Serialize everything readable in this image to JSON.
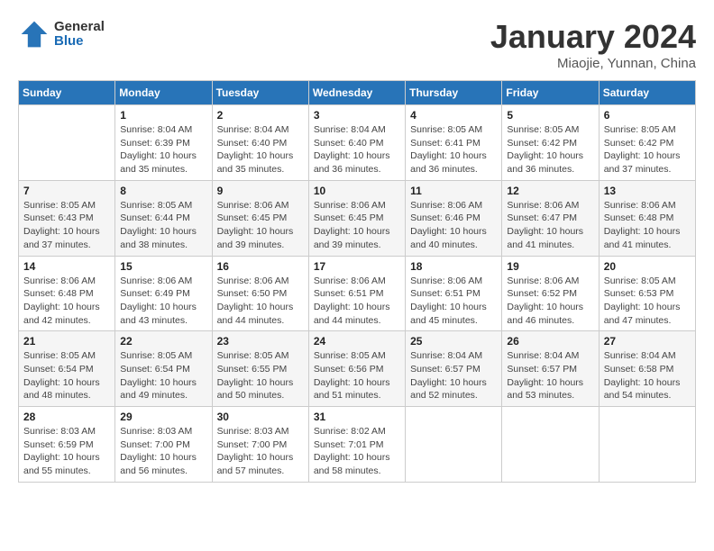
{
  "logo": {
    "general": "General",
    "blue": "Blue"
  },
  "title": "January 2024",
  "subtitle": "Miaojie, Yunnan, China",
  "weekdays": [
    "Sunday",
    "Monday",
    "Tuesday",
    "Wednesday",
    "Thursday",
    "Friday",
    "Saturday"
  ],
  "weeks": [
    [
      {
        "day": "",
        "sunrise": "",
        "sunset": "",
        "daylight": ""
      },
      {
        "day": "1",
        "sunrise": "Sunrise: 8:04 AM",
        "sunset": "Sunset: 6:39 PM",
        "daylight": "Daylight: 10 hours and 35 minutes."
      },
      {
        "day": "2",
        "sunrise": "Sunrise: 8:04 AM",
        "sunset": "Sunset: 6:40 PM",
        "daylight": "Daylight: 10 hours and 35 minutes."
      },
      {
        "day": "3",
        "sunrise": "Sunrise: 8:04 AM",
        "sunset": "Sunset: 6:40 PM",
        "daylight": "Daylight: 10 hours and 36 minutes."
      },
      {
        "day": "4",
        "sunrise": "Sunrise: 8:05 AM",
        "sunset": "Sunset: 6:41 PM",
        "daylight": "Daylight: 10 hours and 36 minutes."
      },
      {
        "day": "5",
        "sunrise": "Sunrise: 8:05 AM",
        "sunset": "Sunset: 6:42 PM",
        "daylight": "Daylight: 10 hours and 36 minutes."
      },
      {
        "day": "6",
        "sunrise": "Sunrise: 8:05 AM",
        "sunset": "Sunset: 6:42 PM",
        "daylight": "Daylight: 10 hours and 37 minutes."
      }
    ],
    [
      {
        "day": "7",
        "sunrise": "Sunrise: 8:05 AM",
        "sunset": "Sunset: 6:43 PM",
        "daylight": "Daylight: 10 hours and 37 minutes."
      },
      {
        "day": "8",
        "sunrise": "Sunrise: 8:05 AM",
        "sunset": "Sunset: 6:44 PM",
        "daylight": "Daylight: 10 hours and 38 minutes."
      },
      {
        "day": "9",
        "sunrise": "Sunrise: 8:06 AM",
        "sunset": "Sunset: 6:45 PM",
        "daylight": "Daylight: 10 hours and 39 minutes."
      },
      {
        "day": "10",
        "sunrise": "Sunrise: 8:06 AM",
        "sunset": "Sunset: 6:45 PM",
        "daylight": "Daylight: 10 hours and 39 minutes."
      },
      {
        "day": "11",
        "sunrise": "Sunrise: 8:06 AM",
        "sunset": "Sunset: 6:46 PM",
        "daylight": "Daylight: 10 hours and 40 minutes."
      },
      {
        "day": "12",
        "sunrise": "Sunrise: 8:06 AM",
        "sunset": "Sunset: 6:47 PM",
        "daylight": "Daylight: 10 hours and 41 minutes."
      },
      {
        "day": "13",
        "sunrise": "Sunrise: 8:06 AM",
        "sunset": "Sunset: 6:48 PM",
        "daylight": "Daylight: 10 hours and 41 minutes."
      }
    ],
    [
      {
        "day": "14",
        "sunrise": "Sunrise: 8:06 AM",
        "sunset": "Sunset: 6:48 PM",
        "daylight": "Daylight: 10 hours and 42 minutes."
      },
      {
        "day": "15",
        "sunrise": "Sunrise: 8:06 AM",
        "sunset": "Sunset: 6:49 PM",
        "daylight": "Daylight: 10 hours and 43 minutes."
      },
      {
        "day": "16",
        "sunrise": "Sunrise: 8:06 AM",
        "sunset": "Sunset: 6:50 PM",
        "daylight": "Daylight: 10 hours and 44 minutes."
      },
      {
        "day": "17",
        "sunrise": "Sunrise: 8:06 AM",
        "sunset": "Sunset: 6:51 PM",
        "daylight": "Daylight: 10 hours and 44 minutes."
      },
      {
        "day": "18",
        "sunrise": "Sunrise: 8:06 AM",
        "sunset": "Sunset: 6:51 PM",
        "daylight": "Daylight: 10 hours and 45 minutes."
      },
      {
        "day": "19",
        "sunrise": "Sunrise: 8:06 AM",
        "sunset": "Sunset: 6:52 PM",
        "daylight": "Daylight: 10 hours and 46 minutes."
      },
      {
        "day": "20",
        "sunrise": "Sunrise: 8:05 AM",
        "sunset": "Sunset: 6:53 PM",
        "daylight": "Daylight: 10 hours and 47 minutes."
      }
    ],
    [
      {
        "day": "21",
        "sunrise": "Sunrise: 8:05 AM",
        "sunset": "Sunset: 6:54 PM",
        "daylight": "Daylight: 10 hours and 48 minutes."
      },
      {
        "day": "22",
        "sunrise": "Sunrise: 8:05 AM",
        "sunset": "Sunset: 6:54 PM",
        "daylight": "Daylight: 10 hours and 49 minutes."
      },
      {
        "day": "23",
        "sunrise": "Sunrise: 8:05 AM",
        "sunset": "Sunset: 6:55 PM",
        "daylight": "Daylight: 10 hours and 50 minutes."
      },
      {
        "day": "24",
        "sunrise": "Sunrise: 8:05 AM",
        "sunset": "Sunset: 6:56 PM",
        "daylight": "Daylight: 10 hours and 51 minutes."
      },
      {
        "day": "25",
        "sunrise": "Sunrise: 8:04 AM",
        "sunset": "Sunset: 6:57 PM",
        "daylight": "Daylight: 10 hours and 52 minutes."
      },
      {
        "day": "26",
        "sunrise": "Sunrise: 8:04 AM",
        "sunset": "Sunset: 6:57 PM",
        "daylight": "Daylight: 10 hours and 53 minutes."
      },
      {
        "day": "27",
        "sunrise": "Sunrise: 8:04 AM",
        "sunset": "Sunset: 6:58 PM",
        "daylight": "Daylight: 10 hours and 54 minutes."
      }
    ],
    [
      {
        "day": "28",
        "sunrise": "Sunrise: 8:03 AM",
        "sunset": "Sunset: 6:59 PM",
        "daylight": "Daylight: 10 hours and 55 minutes."
      },
      {
        "day": "29",
        "sunrise": "Sunrise: 8:03 AM",
        "sunset": "Sunset: 7:00 PM",
        "daylight": "Daylight: 10 hours and 56 minutes."
      },
      {
        "day": "30",
        "sunrise": "Sunrise: 8:03 AM",
        "sunset": "Sunset: 7:00 PM",
        "daylight": "Daylight: 10 hours and 57 minutes."
      },
      {
        "day": "31",
        "sunrise": "Sunrise: 8:02 AM",
        "sunset": "Sunset: 7:01 PM",
        "daylight": "Daylight: 10 hours and 58 minutes."
      },
      {
        "day": "",
        "sunrise": "",
        "sunset": "",
        "daylight": ""
      },
      {
        "day": "",
        "sunrise": "",
        "sunset": "",
        "daylight": ""
      },
      {
        "day": "",
        "sunrise": "",
        "sunset": "",
        "daylight": ""
      }
    ]
  ]
}
